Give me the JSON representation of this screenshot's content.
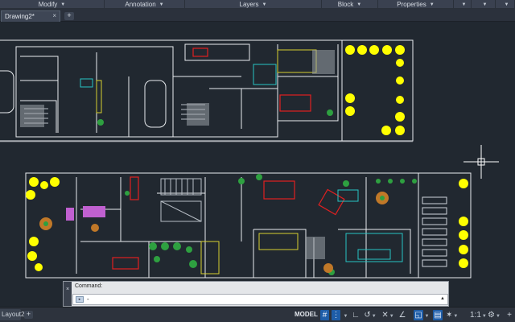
{
  "ribbon": {
    "panels": [
      {
        "label": "Modify"
      },
      {
        "label": "Annotation"
      },
      {
        "label": "Layers"
      },
      {
        "label": "Block"
      },
      {
        "label": "Properties"
      },
      {
        "label": ""
      },
      {
        "label": ""
      },
      {
        "label": ""
      }
    ]
  },
  "file_tabs": {
    "active": "Drawing2*",
    "close_glyph": "×",
    "new_tab_glyph": "+"
  },
  "command_line": {
    "label": "Command:",
    "prompt": "-",
    "icon": "command-prompt-icon",
    "side_close_glyph": "×"
  },
  "status_bar": {
    "layout_tab": "Layout2",
    "layout_add_glyph": "+",
    "model": "MODEL"
  },
  "colors": {
    "background": "#212830",
    "ribbon": "#3a4150",
    "walls": "#e9ecef",
    "trees": "#ffff00",
    "furniture_red": "#e02020",
    "furniture_green": "#2ea040",
    "furniture_cyan": "#27c4c4",
    "furniture_magenta": "#c060d0",
    "furniture_orange": "#c07828",
    "status_active": "#1e5da8"
  }
}
